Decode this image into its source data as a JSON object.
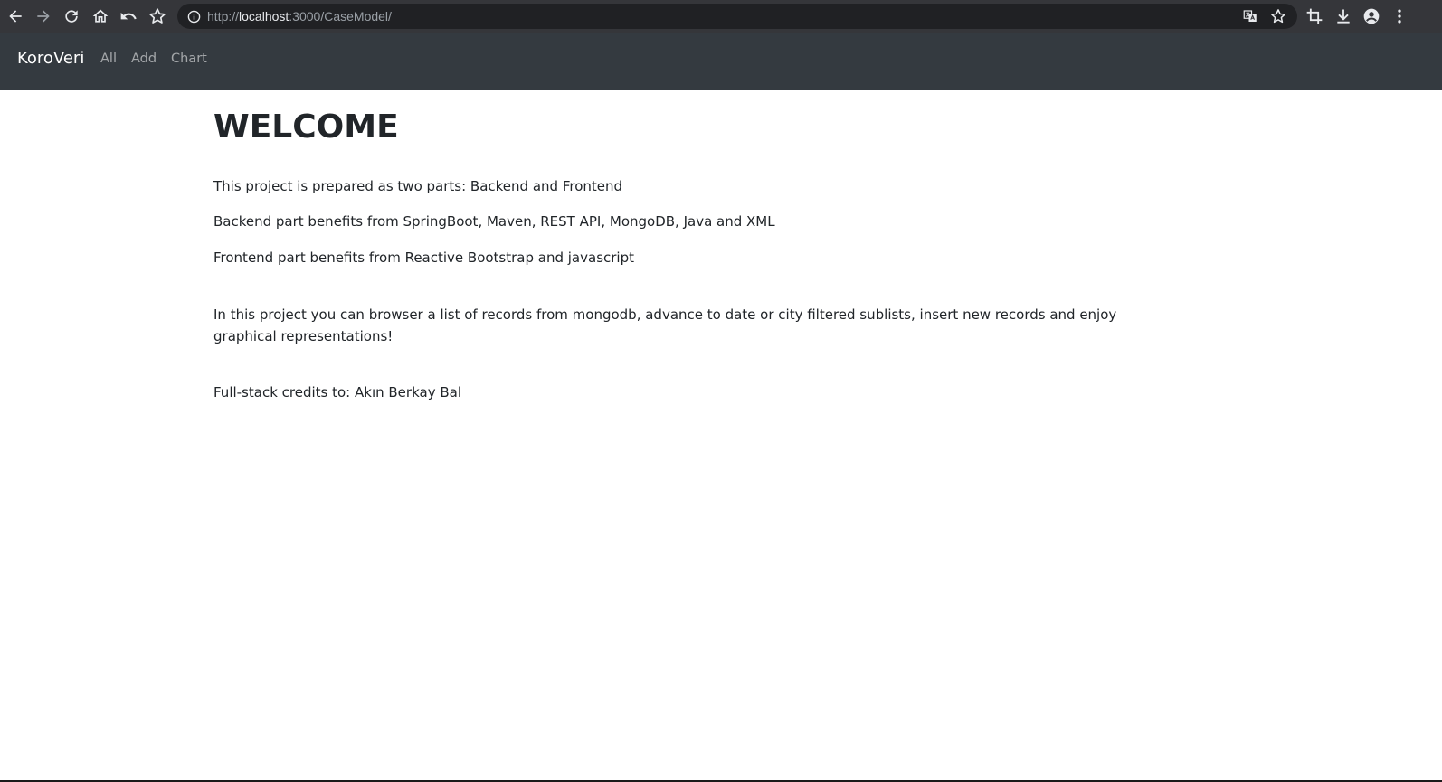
{
  "browser": {
    "url_scheme": "http://",
    "url_host": "localhost",
    "url_rest": ":3000/CaseModel/",
    "icons": {
      "back": "arrow-left-icon",
      "forward": "arrow-right-icon",
      "reload": "reload-icon",
      "home": "home-icon",
      "undo": "undo-icon",
      "bookmark": "star-icon",
      "info": "info-icon",
      "translate": "translate-icon",
      "bookmark_page": "star-icon",
      "crop": "crop-icon",
      "download": "download-icon",
      "profile": "account-icon",
      "menu": "kebab-menu-icon"
    }
  },
  "navbar": {
    "brand": "KoroVeri",
    "links": [
      "All",
      "Add",
      "Chart"
    ],
    "background": "#343a40"
  },
  "main": {
    "title": "WELCOME",
    "paragraphs": [
      "This project is prepared as two parts: Backend and Frontend",
      "Backend part benefits from SpringBoot, Maven, REST API, MongoDB, Java and XML",
      "Frontend part benefits from Reactive Bootstrap and javascript",
      "In this project you can browser a list of records from mongodb, advance to date or city filtered sublists, insert new records and enjoy graphical representations!",
      "Full-stack credits to: Akın Berkay Bal"
    ]
  }
}
